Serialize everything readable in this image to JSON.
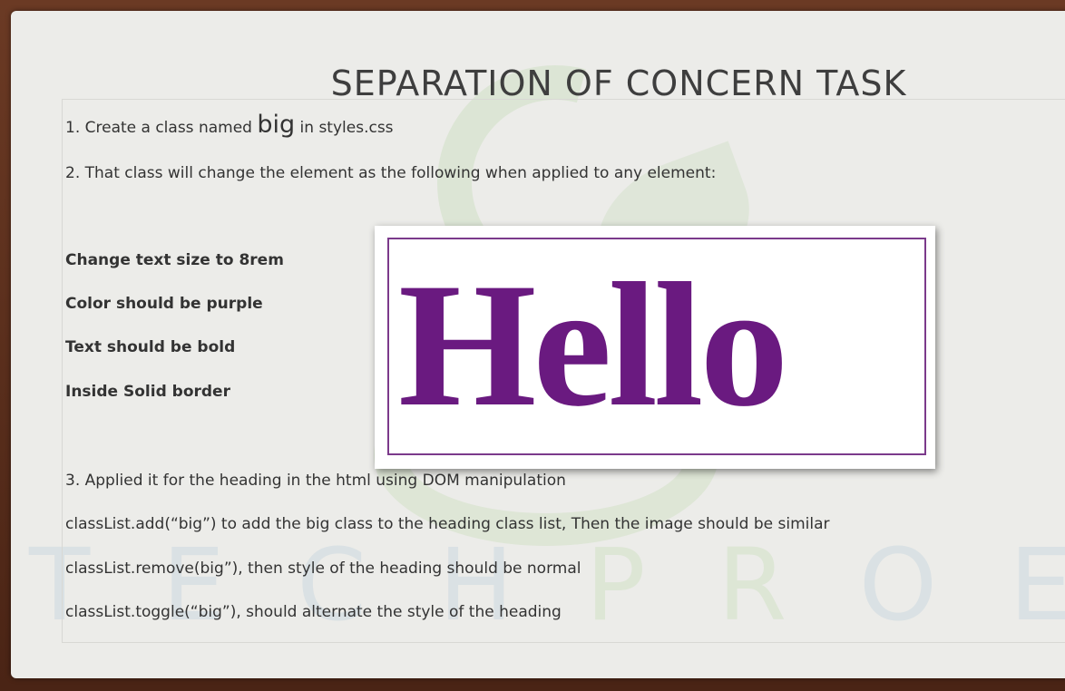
{
  "slide": {
    "title": "SEPARATION OF CONCERN TASK",
    "watermark_letters": [
      "T",
      "E",
      "C",
      "H",
      "P",
      "R",
      "O",
      "E"
    ],
    "step1": {
      "prefix": "1. Create a class named ",
      "class_name": "big",
      "suffix": " in styles.css"
    },
    "step2": "2. That class will change the element as the following when applied to any element:",
    "requirements": [
      "Change text size to 8rem",
      "Color should be purple",
      "Text should be bold",
      "Inside Solid border"
    ],
    "example": {
      "text": "Hello",
      "color": "#6a1a80",
      "border_color": "#7b3a8b"
    },
    "step3": "3. Applied it for the heading in the html using DOM manipulation",
    "class_list_notes": [
      "classList.add(“big”) to add the big class to the heading class list, Then the image should be similar",
      "classList.remove(big”), then style of the heading should be normal",
      "classList.toggle(“big”), should alternate the style of the heading"
    ]
  },
  "colors": {
    "slide_background": "#ecece9",
    "frame": "#5a2e1c",
    "text": "#333333"
  }
}
